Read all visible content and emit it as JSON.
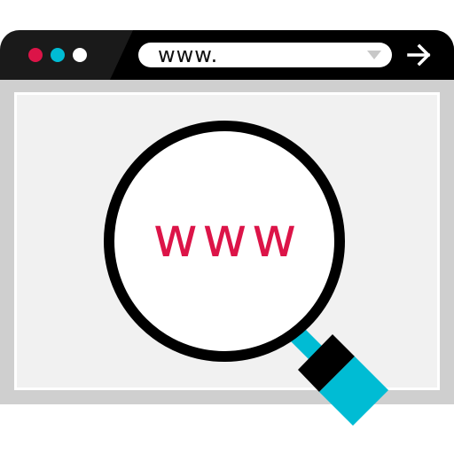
{
  "colors": {
    "chrome_dark": "#1a1a1a",
    "frame_gray": "#cfcfcf",
    "content_bg": "#f1f1f1",
    "accent_red": "#dc1448",
    "accent_cyan": "#00bcd4",
    "dot_white": "#ffffff"
  },
  "titlebar": {
    "window_controls": [
      {
        "name": "red-dot",
        "color": "#dc1448"
      },
      {
        "name": "cyan-dot",
        "color": "#00bcd4"
      },
      {
        "name": "white-dot",
        "color": "#ffffff"
      }
    ]
  },
  "address_bar": {
    "url": "www.",
    "dropdown_icon": "chevron-down-icon",
    "go_icon": "arrow-right-icon"
  },
  "content": {
    "search_icon": "magnifying-glass-icon",
    "lens_text": "www"
  }
}
